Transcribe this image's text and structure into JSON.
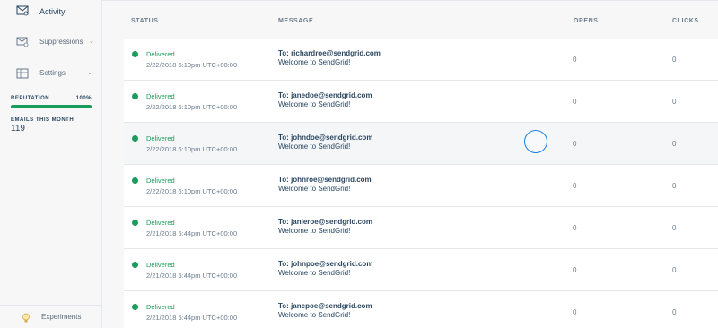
{
  "sidebar": {
    "activity": {
      "label": "Activity",
      "icon": "envelope-search-icon"
    },
    "suppressions": {
      "label": "Suppressions",
      "icon": "envelope-block-icon",
      "chevron": "chevron-down-icon"
    },
    "settings": {
      "label": "Settings",
      "icon": "settings-grid-icon",
      "chevron": "chevron-down-icon"
    },
    "reputation": {
      "label": "REPUTATION",
      "value": "100%",
      "fraction": 1.0
    },
    "emails_this_month": {
      "label": "EMAILS THIS MONTH",
      "count": "119"
    },
    "experiments": {
      "label": "Experiments",
      "icon": "lightbulb-icon"
    }
  },
  "table": {
    "headers": {
      "status": "STATUS",
      "message": "MESSAGE",
      "opens": "OPENS",
      "clicks": "CLICKS"
    },
    "rows": [
      {
        "status": "Delivered",
        "time": "2/22/2018 6:10pm UTC+00:00",
        "to": "To: richardroe@sendgrid.com",
        "subject": "Welcome to SendGrid!",
        "opens": "0",
        "clicks": "0"
      },
      {
        "status": "Delivered",
        "time": "2/22/2018 6:10pm UTC+00:00",
        "to": "To: janedoe@sendgrid.com",
        "subject": "Welcome to SendGrid!",
        "opens": "0",
        "clicks": "0"
      },
      {
        "status": "Delivered",
        "time": "2/22/2018 6:10pm UTC+00:00",
        "to": "To: johndoe@sendgrid.com",
        "subject": "Welcome to SendGrid!",
        "opens": "0",
        "clicks": "0"
      },
      {
        "status": "Delivered",
        "time": "2/22/2018 6:10pm UTC+00:00",
        "to": "To: johnroe@sendgrid.com",
        "subject": "Welcome to SendGrid!",
        "opens": "0",
        "clicks": "0"
      },
      {
        "status": "Delivered",
        "time": "2/21/2018 5:44pm UTC+00:00",
        "to": "To: janieroe@sendgrid.com",
        "subject": "Welcome to SendGrid!",
        "opens": "0",
        "clicks": "0"
      },
      {
        "status": "Delivered",
        "time": "2/21/2018 5:44pm UTC+00:00",
        "to": "To: johnpoe@sendgrid.com",
        "subject": "Welcome to SendGrid!",
        "opens": "0",
        "clicks": "0"
      },
      {
        "status": "Delivered",
        "time": "2/21/2018 5:44pm UTC+00:00",
        "to": "To: janepoe@sendgrid.com",
        "subject": "Welcome to SendGrid!",
        "opens": "0",
        "clicks": "0"
      }
    ]
  },
  "colors": {
    "delivered": "#1a9c5b",
    "text": "#294661",
    "accent": "#1a82e2"
  }
}
